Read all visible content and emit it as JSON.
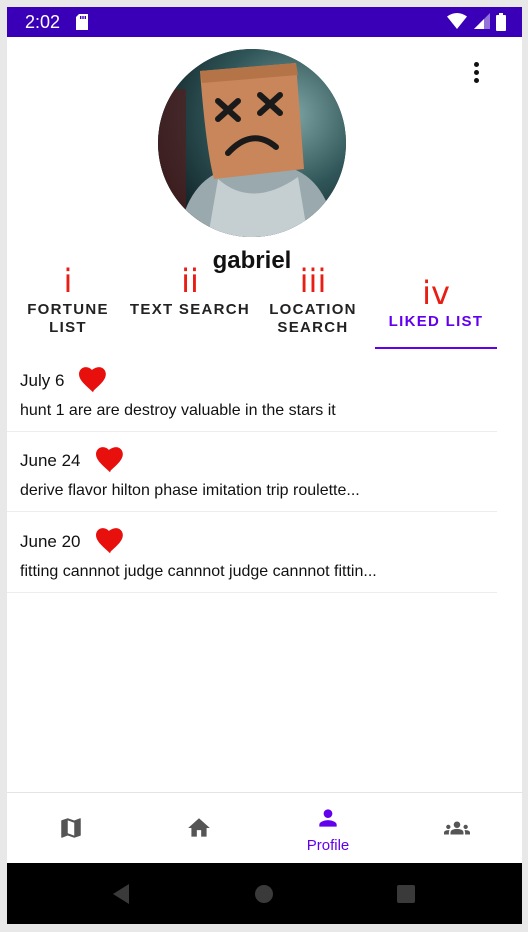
{
  "status_bar": {
    "time": "2:02"
  },
  "profile": {
    "username": "gabriel"
  },
  "tabs": [
    {
      "num": "i",
      "label": "Fortune List"
    },
    {
      "num": "ii",
      "label": "Text Search"
    },
    {
      "num": "iii",
      "label": "Location Search"
    },
    {
      "num": "iv",
      "label": "Liked List"
    }
  ],
  "active_tab": "Liked List",
  "liked_list": [
    {
      "date": "July 6",
      "text": "hunt 1 are are destroy valuable in the stars it"
    },
    {
      "date": "June 24",
      "text": "derive flavor hilton phase imitation trip roulette..."
    },
    {
      "date": "June 20",
      "text": "fitting cannnot judge cannnot judge cannnot fittin..."
    }
  ],
  "bottom_nav": {
    "items": [
      {
        "icon": "map-icon",
        "label": ""
      },
      {
        "icon": "home-icon",
        "label": ""
      },
      {
        "icon": "person-icon",
        "label": "Profile"
      },
      {
        "icon": "group-icon",
        "label": ""
      }
    ],
    "active": "Profile"
  },
  "colors": {
    "accent": "#6200ee",
    "status_bar": "#3a00b8",
    "heart": "#e8100d",
    "roman_numeral": "#e81e14"
  }
}
